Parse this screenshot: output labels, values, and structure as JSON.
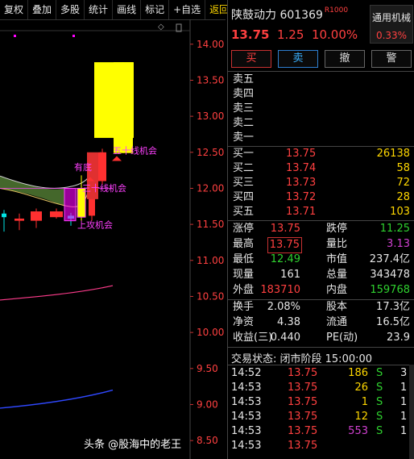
{
  "toolbar": {
    "items": [
      "复权",
      "叠加",
      "多股",
      "统计",
      "画线",
      "标记",
      "+自选"
    ],
    "back": "返回"
  },
  "chart_data": {
    "type": "candlestick",
    "ylim": [
      8.3,
      14.3
    ],
    "y_ticks": [
      "14.00",
      "13.50",
      "13.00",
      "12.50",
      "12.00",
      "11.50",
      "11.00",
      "10.50",
      "10.00",
      "9.50",
      "9.00",
      "8.50"
    ],
    "y_tick_values": [
      14.0,
      13.5,
      13.0,
      12.5,
      12.0,
      11.5,
      11.0,
      10.5,
      10.0,
      9.5,
      9.0,
      8.5
    ],
    "candles": [
      {
        "o": 11.6,
        "h": 11.7,
        "l": 11.4,
        "c": 11.65,
        "dir": "flat"
      },
      {
        "o": 11.58,
        "h": 11.65,
        "l": 11.42,
        "c": 11.55,
        "dir": "down"
      },
      {
        "o": 11.55,
        "h": 11.72,
        "l": 11.45,
        "c": 11.68,
        "dir": "up"
      },
      {
        "o": 11.68,
        "h": 11.72,
        "l": 11.58,
        "c": 11.6,
        "dir": "down"
      },
      {
        "o": 11.58,
        "h": 11.66,
        "l": 11.48,
        "c": 11.62,
        "dir": "flat"
      },
      {
        "o": 11.6,
        "h": 12.18,
        "l": 11.55,
        "c": 12.0,
        "dir": "limitup"
      },
      {
        "o": 11.62,
        "h": 12.08,
        "l": 11.55,
        "c": 12.08,
        "dir": "up"
      },
      {
        "o": 12.1,
        "h": 12.55,
        "l": 12.05,
        "c": 12.5,
        "dir": "up"
      },
      {
        "o": 12.49,
        "h": 13.75,
        "l": 12.49,
        "c": 13.75,
        "dir": "limitup"
      }
    ],
    "annotations": [
      "有底",
      "五十线机会",
      "三十线机会",
      "上攻机会"
    ],
    "colors": {
      "up": "#ff3030",
      "down": "#ff3030",
      "flat": "#00e5e5",
      "limitup": "#ffff00",
      "signal": "#ff00ff"
    }
  },
  "stock": {
    "name": "陕鼓动力",
    "code": "601369",
    "tag": "R",
    "tag_sub": "1000",
    "price": "13.75",
    "change": "1.25",
    "change_pct": "10.00%",
    "industry": "通用机械",
    "industry_pct": "0.33%"
  },
  "buttons": {
    "buy": "买",
    "sell": "卖",
    "cancel": "撤",
    "alert": "警"
  },
  "asks": [
    {
      "label": "卖五",
      "price": "",
      "vol": ""
    },
    {
      "label": "卖四",
      "price": "",
      "vol": ""
    },
    {
      "label": "卖三",
      "price": "",
      "vol": ""
    },
    {
      "label": "卖二",
      "price": "",
      "vol": ""
    },
    {
      "label": "卖一",
      "price": "",
      "vol": ""
    }
  ],
  "bids": [
    {
      "label": "买一",
      "price": "13.75",
      "vol": "26138"
    },
    {
      "label": "买二",
      "price": "13.74",
      "vol": "58"
    },
    {
      "label": "买三",
      "price": "13.73",
      "vol": "72"
    },
    {
      "label": "买四",
      "price": "13.72",
      "vol": "28"
    },
    {
      "label": "买五",
      "price": "13.71",
      "vol": "103"
    }
  ],
  "stats1": [
    {
      "l1": "涨停",
      "v1": "13.75",
      "l2": "跌停",
      "v2": "11.25"
    },
    {
      "l1": "最高",
      "v1": "13.75",
      "l2": "量比",
      "v2": "3.13"
    },
    {
      "l1": "最低",
      "v1": "12.49",
      "l2": "市值",
      "v2": "237.4亿"
    },
    {
      "l1": "现量",
      "v1": "161",
      "l2": "总量",
      "v2": "343478"
    },
    {
      "l1": "外盘",
      "v1": "183710",
      "l2": "内盘",
      "v2": "159768"
    }
  ],
  "stats2": [
    {
      "l1": "换手",
      "v1": "2.08%",
      "l2": "股本",
      "v2": "17.3亿"
    },
    {
      "l1": "净资",
      "v1": "4.38",
      "l2": "流通",
      "v2": "16.5亿"
    },
    {
      "l1": "收益(三)",
      "v1": "0.440",
      "l2": "PE(动)",
      "v2": "23.9"
    }
  ],
  "trade_status": "交易状态: 闭市阶段 15:00:00",
  "ticks": [
    {
      "time": "14:52",
      "price": "13.75",
      "vol": "186",
      "side": "S",
      "n": "3"
    },
    {
      "time": "14:53",
      "price": "13.75",
      "vol": "26",
      "side": "S",
      "n": "1"
    },
    {
      "time": "14:53",
      "price": "13.75",
      "vol": "1",
      "side": "S",
      "n": "1"
    },
    {
      "time": "14:53",
      "price": "13.75",
      "vol": "12",
      "side": "S",
      "n": "1"
    },
    {
      "time": "14:53",
      "price": "13.75",
      "vol": "553",
      "side": "S",
      "n": "1"
    },
    {
      "time": "14:53",
      "price": "13.75",
      "vol": "",
      "side": "",
      "n": ""
    }
  ],
  "watermark": "头条 @股海中的老王"
}
